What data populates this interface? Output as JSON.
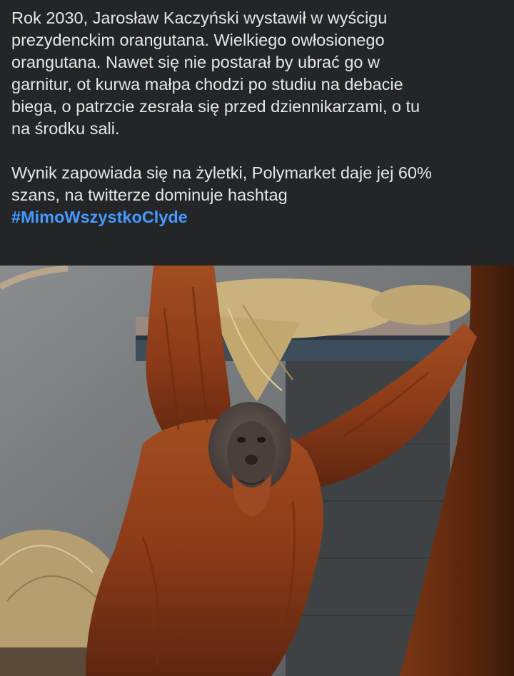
{
  "post": {
    "paragraph_1_lines": [
      "Rok 2030, Jarosław Kaczyński wystawił w wyścigu",
      "prezydenckim orangutana. Wielkiego owłosionego",
      "orangutana. Nawet się nie postarał by ubrać go w",
      "garnitur, ot kurwa małpa chodzi po studiu na debacie",
      "biega, o patrzcie zesrała się przed dziennikarzami, o tu",
      "na środku sali."
    ],
    "paragraph_2_lines": [
      "Wynik zapowiada się na żyletki, Polymarket daje jej 60%",
      "szans, na twitterze dominuje hashtag"
    ],
    "hashtag": "#MimoWszystkoClyde",
    "photo_subject": "orangutan-hanging-in-zoo-enclosure"
  },
  "colors": {
    "background": "#242526",
    "text": "#e4e6eb",
    "hashtag": "#4599ff"
  }
}
